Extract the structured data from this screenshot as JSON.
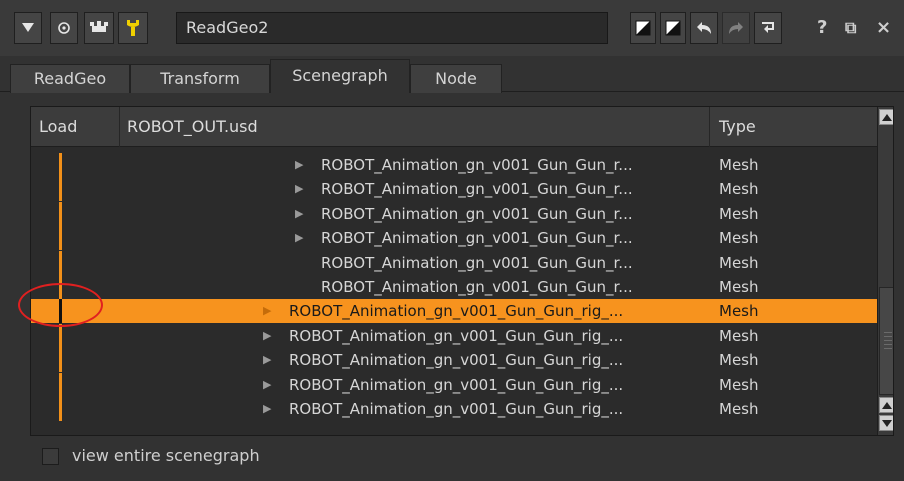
{
  "titlebar": {
    "node_name": "ReadGeo2",
    "help_glyph": "?",
    "float_glyph": "⧉",
    "close_glyph": "×",
    "icons": [
      "collapse-arrow-icon",
      "center-node-icon",
      "knob-default-icon",
      "wrench-icon",
      "color-swatch-icon",
      "color-swatch-icon",
      "undo-icon",
      "redo-icon",
      "revert-icon",
      "help-icon",
      "float-icon",
      "close-icon"
    ]
  },
  "tabs": [
    {
      "label": "ReadGeo",
      "active": false
    },
    {
      "label": "Transform",
      "active": false
    },
    {
      "label": "Scenegraph",
      "active": true
    },
    {
      "label": "Node",
      "active": false
    }
  ],
  "table": {
    "columns": {
      "load": "Load",
      "path": "ROBOT_OUT.usd",
      "type": "Type"
    },
    "rows": [
      {
        "name": "ROBOT_Animation_gn_v001_Gun_Gun_r...",
        "type": "Mesh",
        "expandable": true,
        "selected": false
      },
      {
        "name": "ROBOT_Animation_gn_v001_Gun_Gun_r...",
        "type": "Mesh",
        "expandable": true,
        "selected": false
      },
      {
        "name": "ROBOT_Animation_gn_v001_Gun_Gun_r...",
        "type": "Mesh",
        "expandable": true,
        "selected": false
      },
      {
        "name": "ROBOT_Animation_gn_v001_Gun_Gun_r...",
        "type": "Mesh",
        "expandable": true,
        "selected": false
      },
      {
        "name": "ROBOT_Animation_gn_v001_Gun_Gun_r...",
        "type": "Mesh",
        "expandable": false,
        "selected": false
      },
      {
        "name": "ROBOT_Animation_gn_v001_Gun_Gun_r...",
        "type": "Mesh",
        "expandable": false,
        "selected": false
      },
      {
        "name": "ROBOT_Animation_gn_v001_Gun_Gun_rig_...",
        "type": "Mesh",
        "expandable": true,
        "selected": true
      },
      {
        "name": "ROBOT_Animation_gn_v001_Gun_Gun_rig_...",
        "type": "Mesh",
        "expandable": true,
        "selected": false
      },
      {
        "name": "ROBOT_Animation_gn_v001_Gun_Gun_rig_...",
        "type": "Mesh",
        "expandable": true,
        "selected": false
      },
      {
        "name": "ROBOT_Animation_gn_v001_Gun_Gun_rig_...",
        "type": "Mesh",
        "expandable": true,
        "selected": false
      },
      {
        "name": "ROBOT_Animation_gn_v001_Gun_Gun_rig_...",
        "type": "Mesh",
        "expandable": true,
        "selected": false
      }
    ]
  },
  "footer": {
    "checkbox_label": "view entire scenegraph",
    "checked": false
  },
  "colors": {
    "selection": "#f7931e",
    "load_marker": "#f29019",
    "annotation": "#e02020"
  }
}
